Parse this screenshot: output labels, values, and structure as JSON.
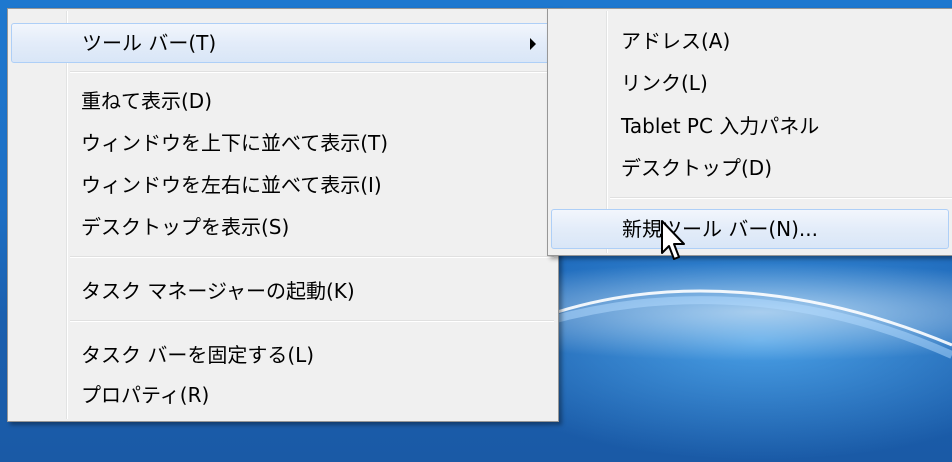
{
  "main_menu": {
    "items": [
      {
        "label": "ツール バー(T)"
      },
      {
        "label": "重ねて表示(D)"
      },
      {
        "label": "ウィンドウを上下に並べて表示(T)"
      },
      {
        "label": "ウィンドウを左右に並べて表示(I)"
      },
      {
        "label": "デスクトップを表示(S)"
      },
      {
        "label": "タスク マネージャーの起動(K)"
      },
      {
        "label": "タスク バーを固定する(L)"
      },
      {
        "label": "プロパティ(R)"
      }
    ]
  },
  "sub_menu": {
    "items": [
      {
        "label": "アドレス(A)"
      },
      {
        "label": "リンク(L)"
      },
      {
        "label": "Tablet PC 入力パネル"
      },
      {
        "label": "デスクトップ(D)"
      },
      {
        "label": "新規ツール バー(N)..."
      }
    ]
  },
  "colors": {
    "highlight_border": "#aecff7",
    "menu_background": "#f0f0f0",
    "desktop_blue": "#1d6fc4"
  },
  "icons": {
    "submenu_arrow": "chevron-right-icon",
    "cursor": "mouse-pointer-icon"
  }
}
